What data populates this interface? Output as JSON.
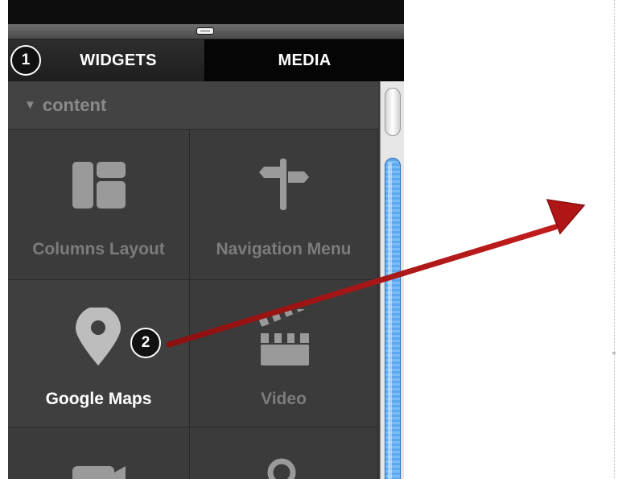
{
  "tabs": [
    {
      "label": "WIDGETS",
      "active": true
    },
    {
      "label": "MEDIA",
      "active": false
    }
  ],
  "section": {
    "toggle_icon": "triangle-down-icon",
    "title": "content"
  },
  "widgets": [
    {
      "label": "Columns Layout",
      "icon": "columns-layout-icon"
    },
    {
      "label": "Navigation Menu",
      "icon": "signpost-icon"
    },
    {
      "label": "Google Maps",
      "icon": "map-pin-icon"
    },
    {
      "label": "Video",
      "icon": "clapperboard-icon"
    },
    {
      "label": "",
      "icon": "camera-icon"
    },
    {
      "label": "",
      "icon": "search-icon"
    }
  ],
  "callouts": [
    "1",
    "2"
  ],
  "colors": {
    "panel": "#3a3a3a",
    "label_dim": "#7c7c7c",
    "label_active": "#ffffff",
    "scroll_thumb": "#5da8ee",
    "arrow": "#b01616"
  }
}
